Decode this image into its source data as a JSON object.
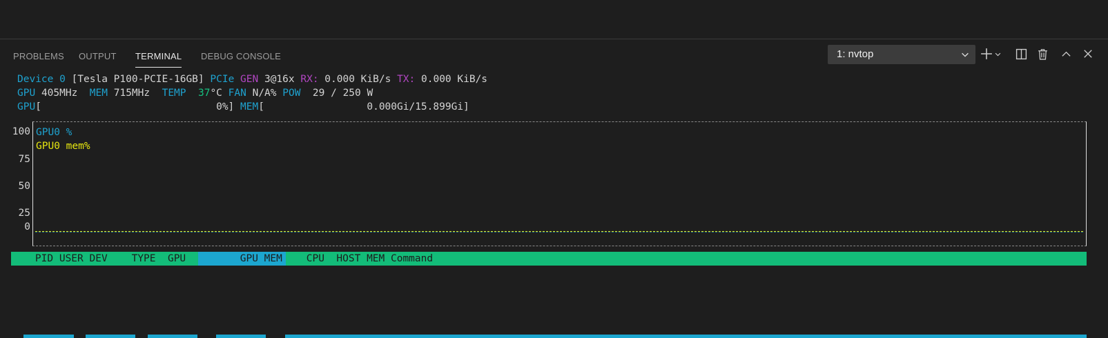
{
  "panel": {
    "tabs": [
      {
        "label": "PROBLEMS"
      },
      {
        "label": "OUTPUT"
      },
      {
        "label": "TERMINAL",
        "active": true
      },
      {
        "label": "DEBUG CONSOLE"
      }
    ],
    "terminal_selector": {
      "value": "1: nvtop",
      "icon": "chevron-down-icon"
    },
    "actions": [
      "plus-icon",
      "chevron-down-icon",
      "split-icon",
      "trash-icon",
      "chevron-up-icon",
      "close-icon"
    ]
  },
  "nvtop": {
    "device_line": {
      "device_label": "Device 0",
      "device_name": "[Tesla P100-PCIE-16GB]",
      "pcie_label": "PCIe",
      "gen_label": "GEN",
      "gen_value": "3@16x",
      "rx_label": "RX:",
      "rx_value": "0.000 KiB/s",
      "tx_label": "TX:",
      "tx_value": "0.000 KiB/s"
    },
    "stats_line": {
      "gpu_label": "GPU",
      "gpu_clock": "405MHz",
      "mem_label": "MEM",
      "mem_clock": "715MHz",
      "temp_label": "TEMP",
      "temp_value": "37",
      "temp_unit": "°C",
      "fan_label": "FAN",
      "fan_value": "N/A%",
      "pow_label": "POW",
      "pow_value": "29 / 250 W"
    },
    "bars_line": {
      "gpu_label": "GPU",
      "gpu_bar": "[                             0%]",
      "mem_label": "MEM",
      "mem_bar": "[                 0.000Gi/15.899Gi]"
    },
    "process_header": {
      "columns_before": "    PID USER DEV    TYPE  GPU   ",
      "selected": "      GPU MEM",
      "columns_after": "    CPU  HOST MEM Command"
    }
  },
  "chart_data": {
    "type": "line",
    "ylim": [
      0,
      100
    ],
    "yticks": [
      "100",
      "75",
      "50",
      "25",
      "0"
    ],
    "series": [
      {
        "name": "GPU0 %",
        "color": "#1ea2cf",
        "values": [
          0
        ]
      },
      {
        "name": "GPU0 mem%",
        "color": "#e5e510",
        "values": [
          0
        ]
      }
    ],
    "legend_position": "top-left"
  }
}
